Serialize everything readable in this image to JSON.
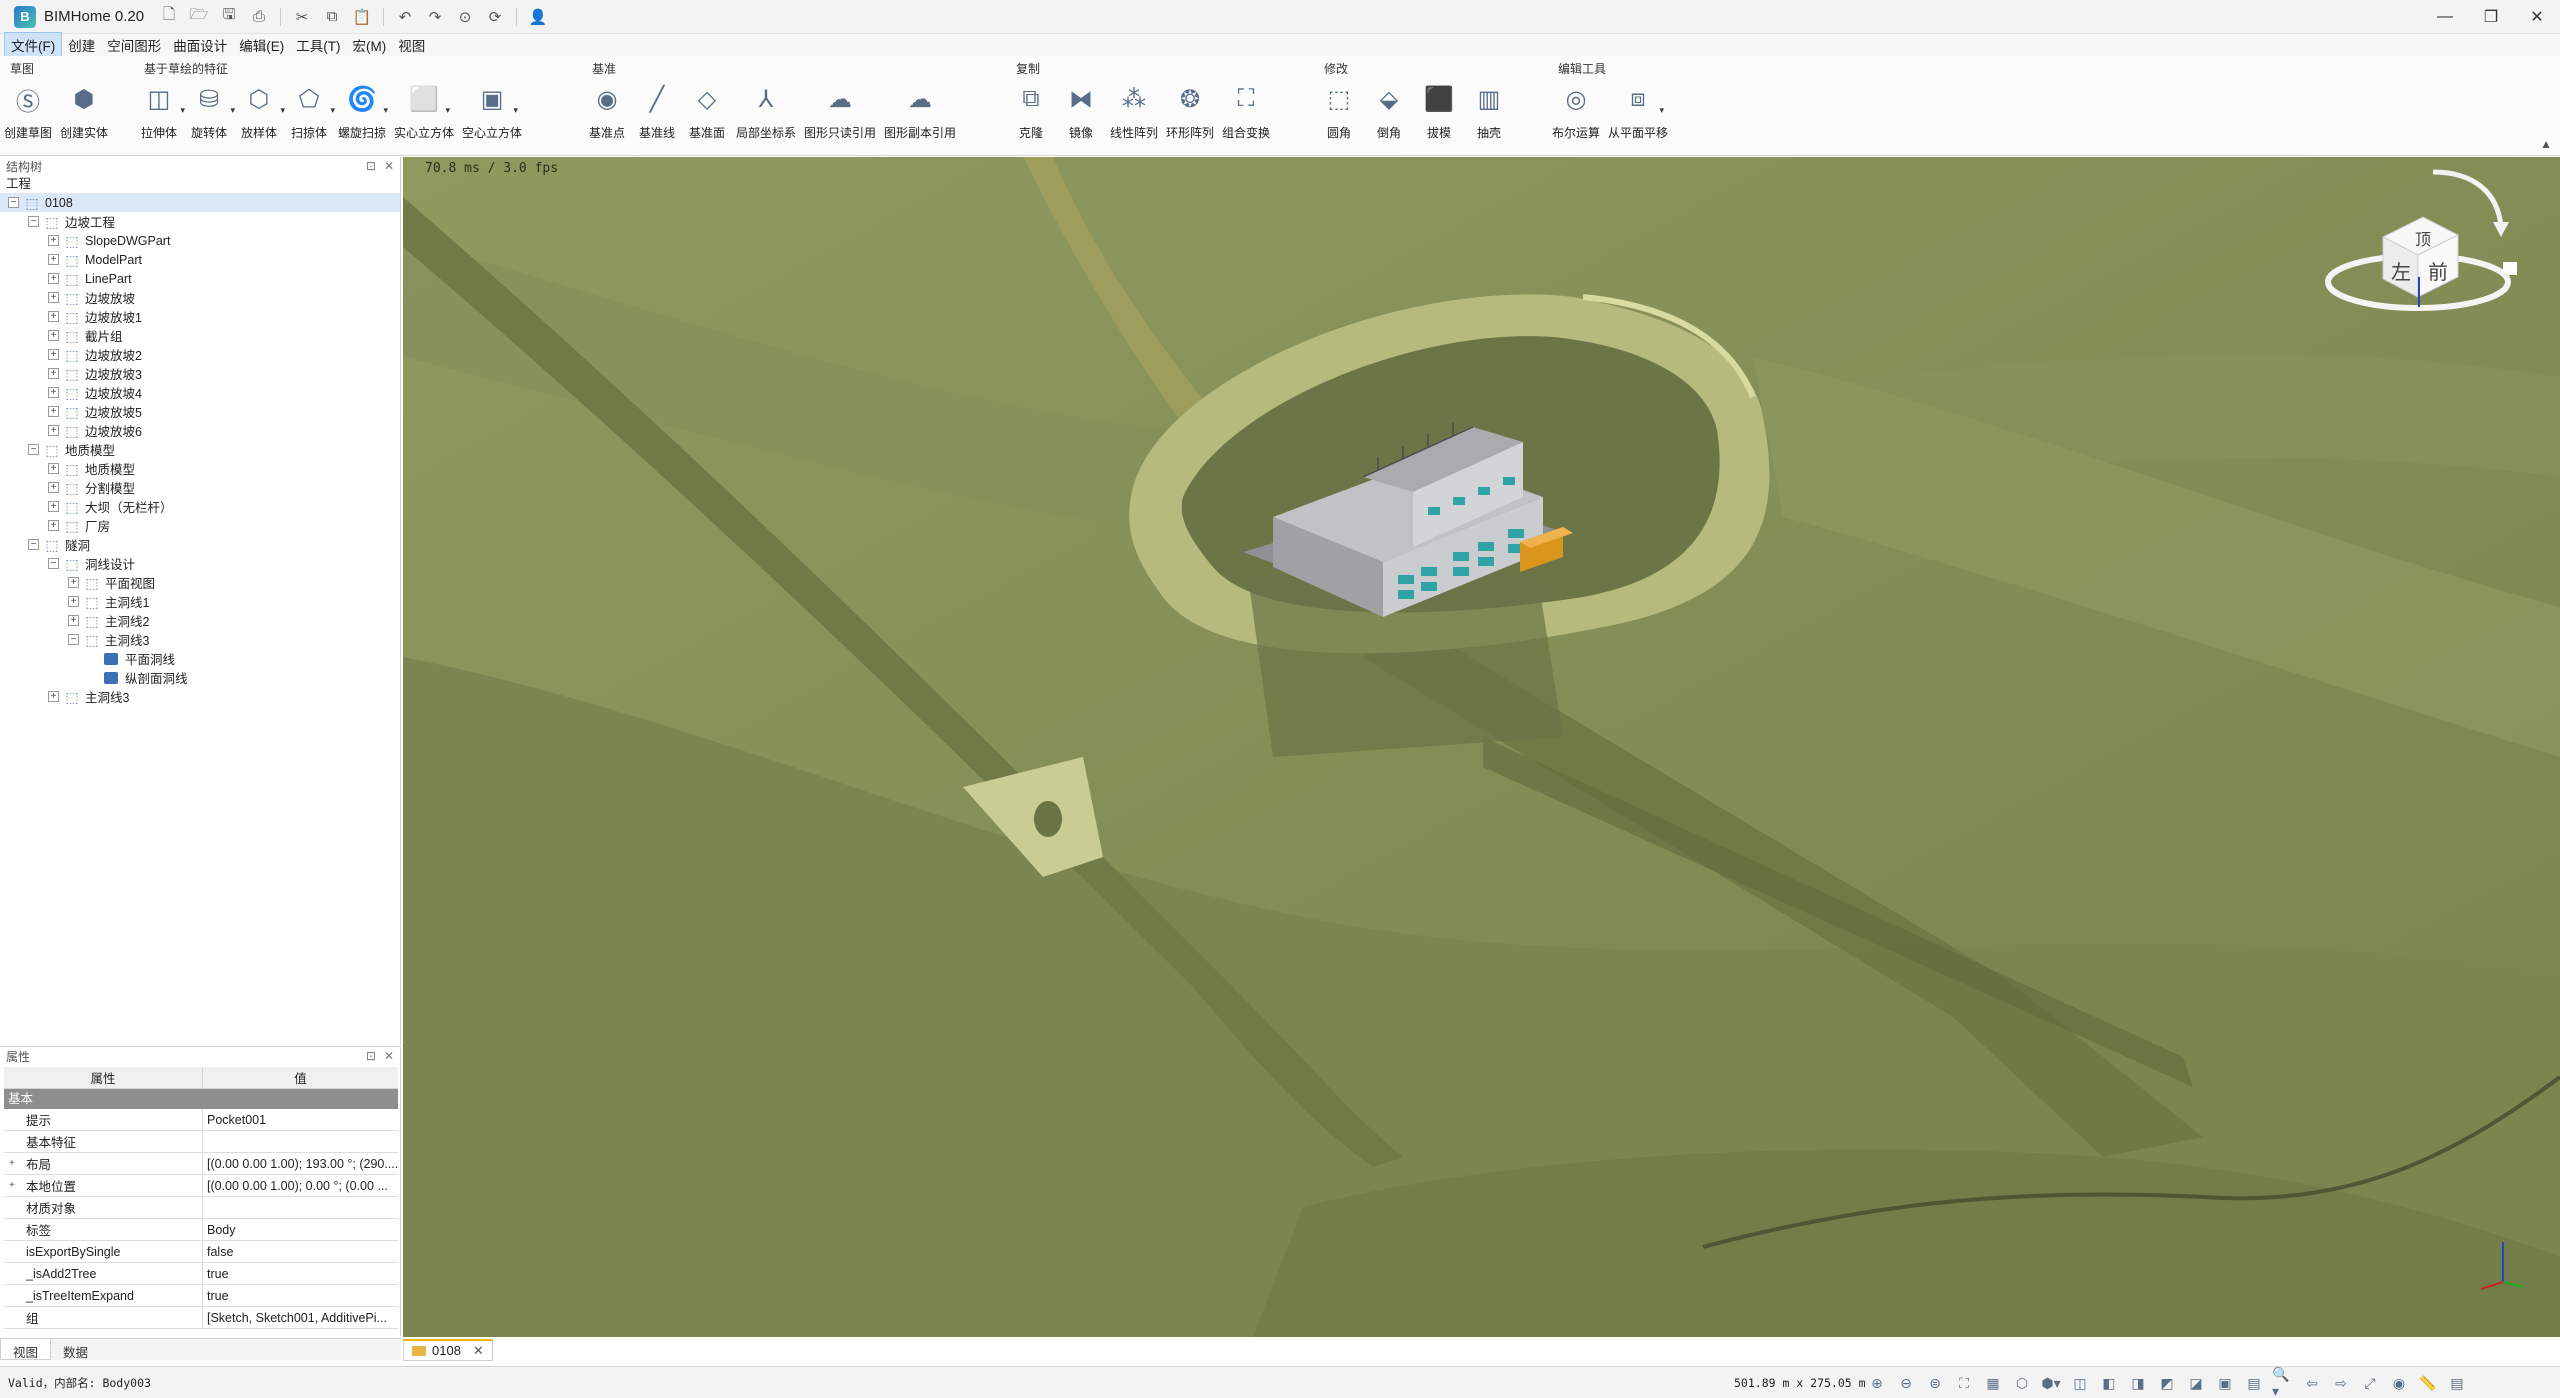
{
  "app": {
    "title": "BIMHome 0.20"
  },
  "menu": [
    "文件(F)",
    "创建",
    "空间图形",
    "曲面设计",
    "编辑(E)",
    "工具(T)",
    "宏(M)",
    "视图"
  ],
  "ribbon": {
    "groups": [
      {
        "title": "草图",
        "tools": [
          {
            "label": "创建草图",
            "icon": "sketch-icon"
          },
          {
            "label": "创建实体",
            "icon": "solid-icon"
          }
        ]
      },
      {
        "title": "基于草绘的特征",
        "tools": [
          {
            "label": "拉伸体",
            "icon": "extrude-icon"
          },
          {
            "label": "旋转体",
            "icon": "revolve-icon"
          },
          {
            "label": "放样体",
            "icon": "loft-icon"
          },
          {
            "label": "扫掠体",
            "icon": "sweep-icon"
          },
          {
            "label": "螺旋扫掠",
            "icon": "helix-sweep-icon"
          },
          {
            "label": "实心立方体",
            "icon": "solid-cube-icon"
          },
          {
            "label": "空心立方体",
            "icon": "hollow-cube-icon"
          }
        ]
      },
      {
        "title": "基准",
        "tools": [
          {
            "label": "基准点",
            "icon": "datum-point-icon"
          },
          {
            "label": "基准线",
            "icon": "datum-line-icon"
          },
          {
            "label": "基准面",
            "icon": "datum-plane-icon"
          },
          {
            "label": "局部坐标系",
            "icon": "local-cs-icon"
          },
          {
            "label": "图形只读引用",
            "icon": "readonly-ref-icon"
          },
          {
            "label": "图形副本引用",
            "icon": "copy-ref-icon"
          }
        ]
      },
      {
        "title": "复制",
        "tools": [
          {
            "label": "克隆",
            "icon": "clone-icon"
          },
          {
            "label": "镜像",
            "icon": "mirror-icon"
          },
          {
            "label": "线性阵列",
            "icon": "linear-array-icon"
          },
          {
            "label": "环形阵列",
            "icon": "polar-array-icon"
          },
          {
            "label": "组合变换",
            "icon": "combined-transform-icon"
          }
        ]
      },
      {
        "title": "修改",
        "tools": [
          {
            "label": "圆角",
            "icon": "fillet-icon"
          },
          {
            "label": "倒角",
            "icon": "chamfer-icon"
          },
          {
            "label": "拔模",
            "icon": "draft-icon"
          },
          {
            "label": "抽壳",
            "icon": "shell-icon"
          }
        ]
      },
      {
        "title": "编辑工具",
        "tools": [
          {
            "label": "布尔运算",
            "icon": "boolean-icon"
          },
          {
            "label": "从平面平移",
            "icon": "plane-translate-icon"
          }
        ]
      }
    ]
  },
  "structure_panel": {
    "title": "结构树",
    "root_label": "工程",
    "nodes": [
      {
        "label": "0108",
        "depth": 0,
        "toggle": "-",
        "selected": true
      },
      {
        "label": "边坡工程",
        "depth": 1,
        "toggle": "-"
      },
      {
        "label": "SlopeDWGPart",
        "depth": 2,
        "toggle": "+"
      },
      {
        "label": "ModelPart",
        "depth": 2,
        "toggle": "+"
      },
      {
        "label": "LinePart",
        "depth": 2,
        "toggle": "+"
      },
      {
        "label": "边坡放坡",
        "depth": 2,
        "toggle": "+"
      },
      {
        "label": "边坡放坡1",
        "depth": 2,
        "toggle": "+"
      },
      {
        "label": "截片组",
        "depth": 2,
        "toggle": "+"
      },
      {
        "label": "边坡放坡2",
        "depth": 2,
        "toggle": "+"
      },
      {
        "label": "边坡放坡3",
        "depth": 2,
        "toggle": "+"
      },
      {
        "label": "边坡放坡4",
        "depth": 2,
        "toggle": "+"
      },
      {
        "label": "边坡放坡5",
        "depth": 2,
        "toggle": "+"
      },
      {
        "label": "边坡放坡6",
        "depth": 2,
        "toggle": "+"
      },
      {
        "label": "地质模型",
        "depth": 1,
        "toggle": "-"
      },
      {
        "label": "地质模型",
        "depth": 2,
        "toggle": "+"
      },
      {
        "label": "分割模型",
        "depth": 2,
        "toggle": "+"
      },
      {
        "label": "大坝（无栏杆）",
        "depth": 2,
        "toggle": "+"
      },
      {
        "label": "厂房",
        "depth": 2,
        "toggle": "+"
      },
      {
        "label": "隧洞",
        "depth": 1,
        "toggle": "-"
      },
      {
        "label": "洞线设计",
        "depth": 2,
        "toggle": "-"
      },
      {
        "label": "平面视图",
        "depth": 3,
        "toggle": "+"
      },
      {
        "label": "主洞线1",
        "depth": 3,
        "toggle": "+"
      },
      {
        "label": "主洞线2",
        "depth": 3,
        "toggle": "+"
      },
      {
        "label": "主洞线3",
        "depth": 3,
        "toggle": "-"
      },
      {
        "label": "平面洞线",
        "depth": 4,
        "toggle": "",
        "solid": true
      },
      {
        "label": "纵剖面洞线",
        "depth": 4,
        "toggle": "",
        "solid": true
      },
      {
        "label": "主洞线3",
        "depth": 2,
        "toggle": "+"
      }
    ]
  },
  "property_panel": {
    "title": "属性",
    "col_name": "属性",
    "col_value": "值",
    "section": "基本",
    "rows": [
      {
        "key": "提示",
        "value": "Pocket001",
        "expand": ""
      },
      {
        "key": "基本特征",
        "value": "",
        "expand": ""
      },
      {
        "key": "布局",
        "value": "[(0.00 0.00 1.00); 193.00 °; (290....",
        "expand": "+"
      },
      {
        "key": "本地位置",
        "value": "[(0.00 0.00 1.00); 0.00 °; (0.00 ...",
        "expand": "+"
      },
      {
        "key": "材质对象",
        "value": "",
        "expand": ""
      },
      {
        "key": "标签",
        "value": "Body",
        "expand": ""
      },
      {
        "key": "isExportBySingle",
        "value": "false",
        "expand": ""
      },
      {
        "key": "_isAdd2Tree",
        "value": "true",
        "expand": ""
      },
      {
        "key": "_isTreeItemExpand",
        "value": "true",
        "expand": ""
      },
      {
        "key": "组",
        "value": "[Sketch, Sketch001, AdditivePi...",
        "expand": ""
      }
    ]
  },
  "left_tabs": [
    "视图",
    "数据"
  ],
  "viewport": {
    "fps_text": "70.8 ms / 3.0 fps",
    "navcube": {
      "top": "顶",
      "left": "左",
      "front": "前"
    },
    "colors": {
      "terrain": "#7f8b55",
      "terrain_light": "#9aa46a",
      "building_wall": "#bfc3c6",
      "window": "#2fa3a6",
      "roof": "#8f9093",
      "accent": "#d9951c"
    }
  },
  "doc_tab": "0108",
  "status": {
    "message": "Valid，内部名: Body003",
    "dimensions": "501.89 m x 275.05 m"
  }
}
